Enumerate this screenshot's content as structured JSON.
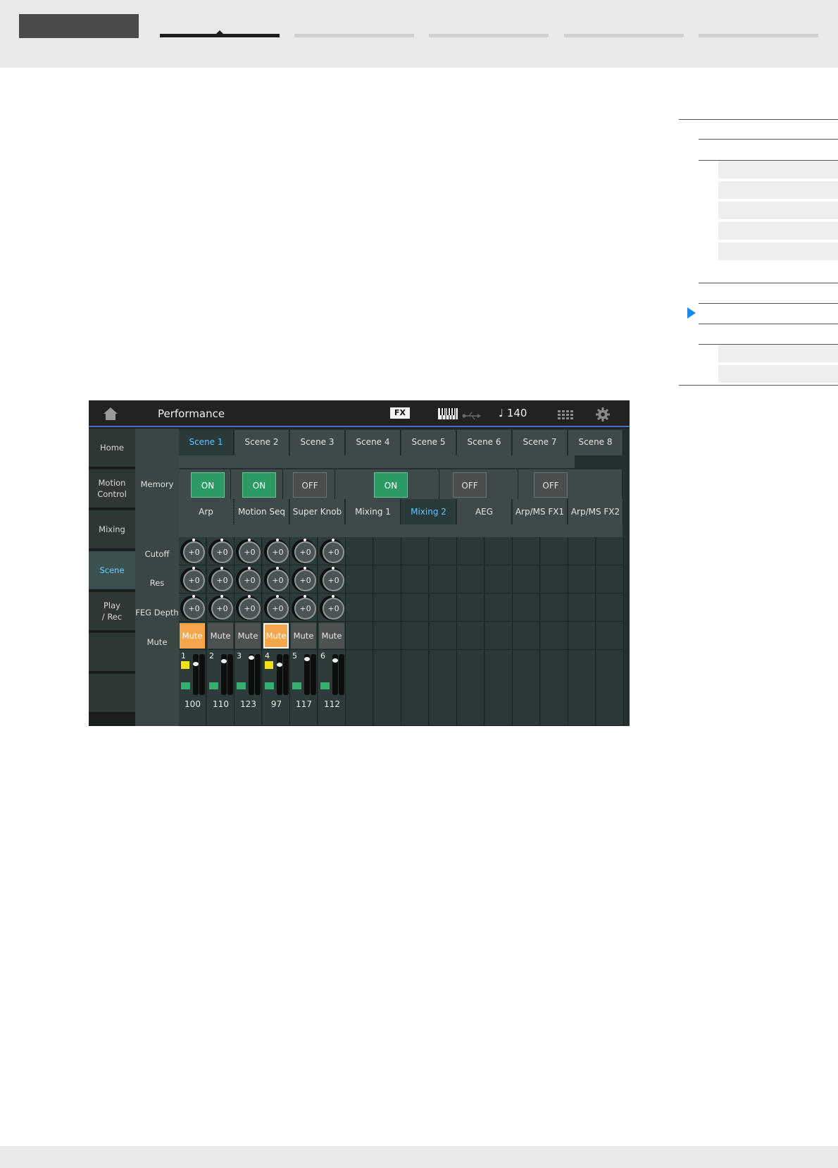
{
  "screen": {
    "title": "Performance",
    "fx_badge": "FX",
    "tempo": "♩ 140",
    "icons": [
      "home-icon",
      "keyboard-icon",
      "usb-icon",
      "grid-icon",
      "gear-icon"
    ]
  },
  "nav": [
    {
      "label": "Home",
      "active": false
    },
    {
      "label": "Motion\nControl",
      "active": false
    },
    {
      "label": "Mixing",
      "active": false
    },
    {
      "label": "Scene",
      "active": true
    },
    {
      "label": "Play\n/ Rec",
      "active": false
    },
    {
      "label": "",
      "active": false
    },
    {
      "label": "",
      "active": false
    }
  ],
  "scenes": [
    "Scene 1",
    "Scene 2",
    "Scene 3",
    "Scene 4",
    "Scene 5",
    "Scene 6",
    "Scene 7",
    "Scene 8"
  ],
  "active_scene": 0,
  "memory": {
    "label": "Memory",
    "buttons": [
      "ON",
      "ON",
      "OFF",
      "ON",
      "OFF",
      "OFF"
    ]
  },
  "categories": [
    "Arp",
    "Motion Seq",
    "Super Knob",
    "Mixing 1",
    "Mixing 2",
    "AEG",
    "Arp/MS FX1",
    "Arp/MS FX2"
  ],
  "active_category": 4,
  "rows": {
    "cutoff": "Cutoff",
    "res": "Res",
    "feg": "FEG Depth",
    "mute": "Mute"
  },
  "parts": [
    {
      "num": "1",
      "cutoff": "+0",
      "res": "+0",
      "feg": "+0",
      "mute": "Mute",
      "mute_on": true,
      "selected": false,
      "tag": true,
      "volume": "100",
      "level": 100
    },
    {
      "num": "2",
      "cutoff": "+0",
      "res": "+0",
      "feg": "+0",
      "mute": "Mute",
      "mute_on": false,
      "selected": false,
      "tag": false,
      "volume": "110",
      "level": 110
    },
    {
      "num": "3",
      "cutoff": "+0",
      "res": "+0",
      "feg": "+0",
      "mute": "Mute",
      "mute_on": false,
      "selected": false,
      "tag": false,
      "volume": "123",
      "level": 123
    },
    {
      "num": "4",
      "cutoff": "+0",
      "res": "+0",
      "feg": "+0",
      "mute": "Mute",
      "mute_on": true,
      "selected": true,
      "tag": true,
      "volume": "97",
      "level": 97
    },
    {
      "num": "5",
      "cutoff": "+0",
      "res": "+0",
      "feg": "+0",
      "mute": "Mute",
      "mute_on": false,
      "selected": false,
      "tag": false,
      "volume": "117",
      "level": 117
    },
    {
      "num": "6",
      "cutoff": "+0",
      "res": "+0",
      "feg": "+0",
      "mute": "Mute",
      "mute_on": false,
      "selected": false,
      "tag": false,
      "volume": "112",
      "level": 112
    }
  ],
  "colors": {
    "accent": "#59c6ff",
    "memory_on": "#2c9b63",
    "mute_on": "#f5a64b",
    "toc_arrow": "#1e88e5"
  }
}
